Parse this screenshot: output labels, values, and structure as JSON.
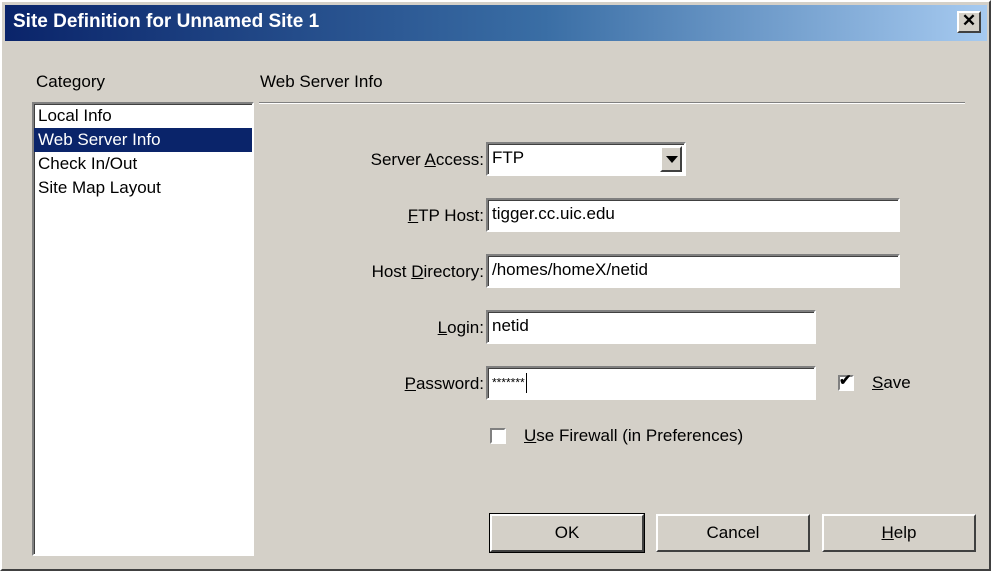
{
  "window": {
    "title": "Site Definition for Unnamed Site 1",
    "close_label": "✕"
  },
  "category": {
    "heading": "Category",
    "items": [
      "Local Info",
      "Web Server Info",
      "Check In/Out",
      "Site Map Layout"
    ],
    "selected": "Web Server Info"
  },
  "section_title": "Web Server Info",
  "form": {
    "server_access": {
      "label_prefix": "Server ",
      "label_mnemonic": "A",
      "label_suffix": "ccess:",
      "value": "FTP"
    },
    "ftp_host": {
      "label_mnemonic": "F",
      "label_suffix": "TP Host:",
      "value": "tigger.cc.uic.edu"
    },
    "host_directory": {
      "label_prefix": "Host ",
      "label_mnemonic": "D",
      "label_suffix": "irectory:",
      "value": "/homes/homeX/netid"
    },
    "login": {
      "label_mnemonic": "L",
      "label_suffix": "ogin:",
      "value": "netid"
    },
    "password": {
      "label_mnemonic": "P",
      "label_suffix": "assword:",
      "value": "*******"
    },
    "save": {
      "label_mnemonic": "S",
      "label_suffix": "ave",
      "checked": true
    },
    "firewall": {
      "label_mnemonic": "U",
      "label_suffix": "se Firewall (in Preferences)",
      "checked": false
    }
  },
  "buttons": {
    "ok": "OK",
    "cancel": "Cancel",
    "help_mnemonic": "H",
    "help_suffix": "elp"
  }
}
